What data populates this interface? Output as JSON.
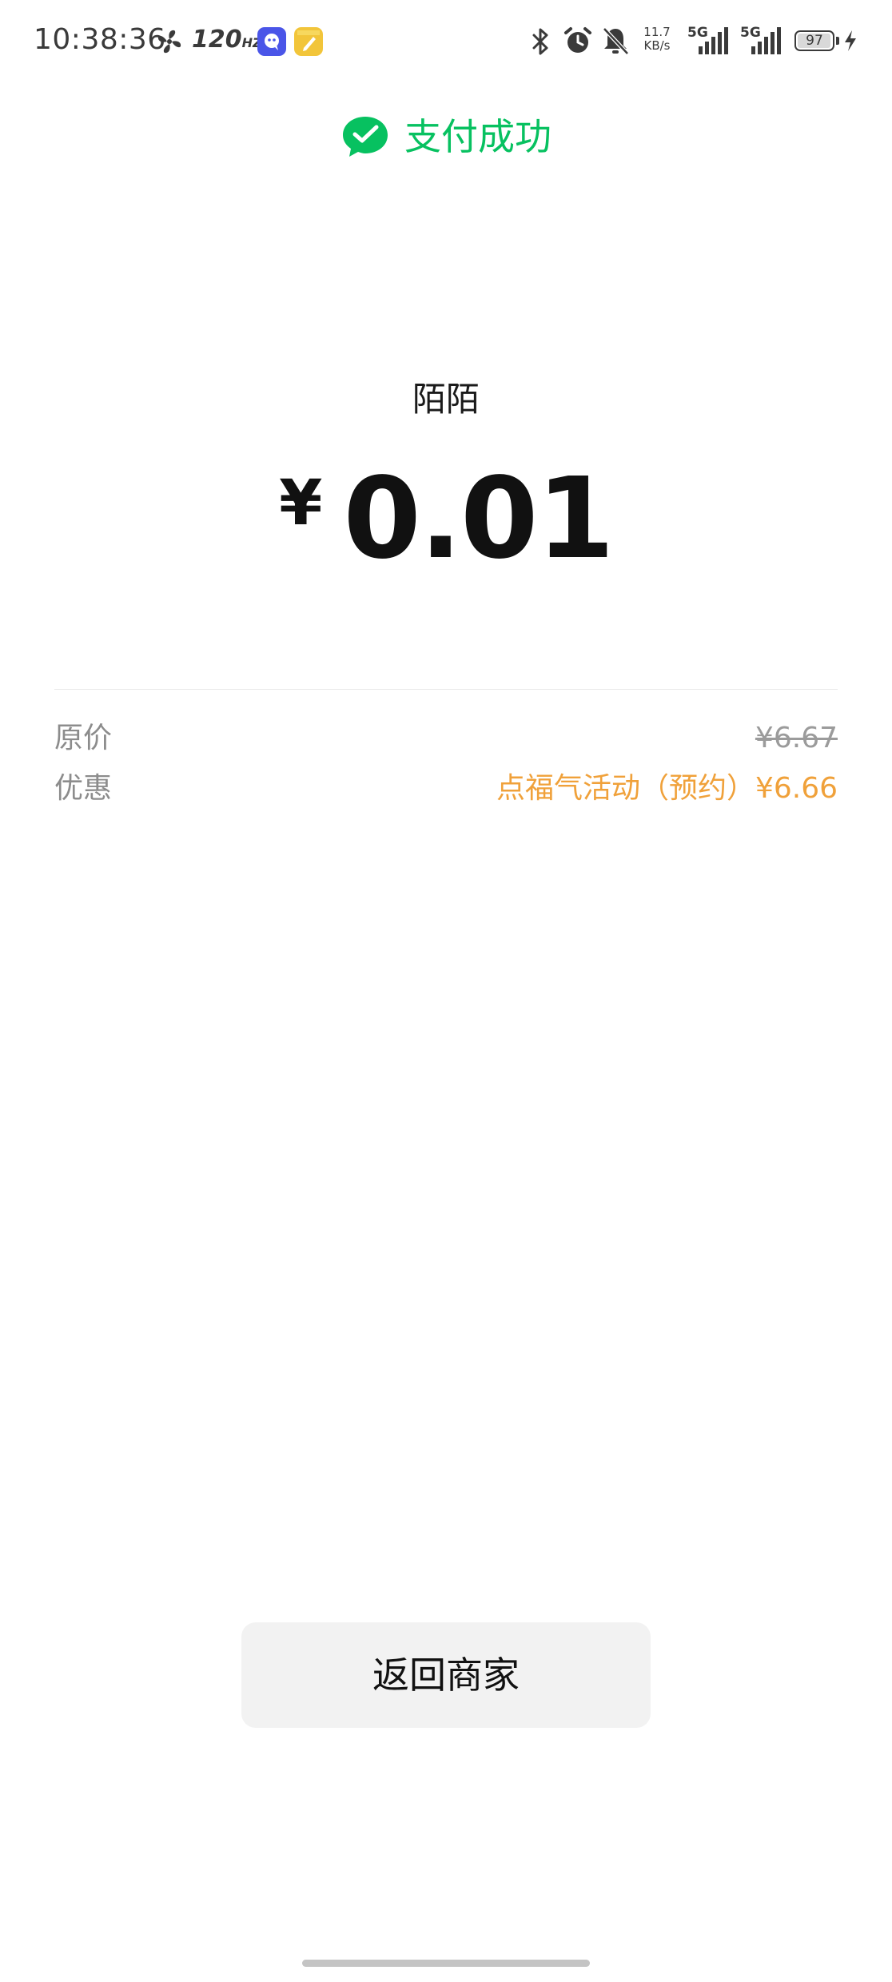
{
  "status_bar": {
    "time": "10:38:36",
    "refresh_rate": "120",
    "refresh_unit": "HZ",
    "net_speed_value": "11.7",
    "net_speed_unit": "KB/s",
    "network1": "5G",
    "network2": "5G",
    "battery_level": "97",
    "battery_fraction": 0.97,
    "icons": [
      "fan-icon",
      "app-icon",
      "note-icon",
      "bluetooth-icon",
      "alarm-icon",
      "bell-muted-icon",
      "signal-icon",
      "battery-icon",
      "charging-icon"
    ]
  },
  "header": {
    "title": "支付成功",
    "icon": "wechat-pay-icon"
  },
  "payment": {
    "merchant": "陌陌",
    "currency_symbol": "¥",
    "amount": "0.01"
  },
  "details": {
    "original_label": "原价",
    "original_value": "¥6.67",
    "discount_label": "优惠",
    "discount_value": "点福气活动（预约）¥6.66"
  },
  "actions": {
    "return_label": "返回商家"
  },
  "colors": {
    "brand_green": "#07c160",
    "discount_orange": "#f0a13a",
    "button_bg": "#f2f2f2"
  }
}
